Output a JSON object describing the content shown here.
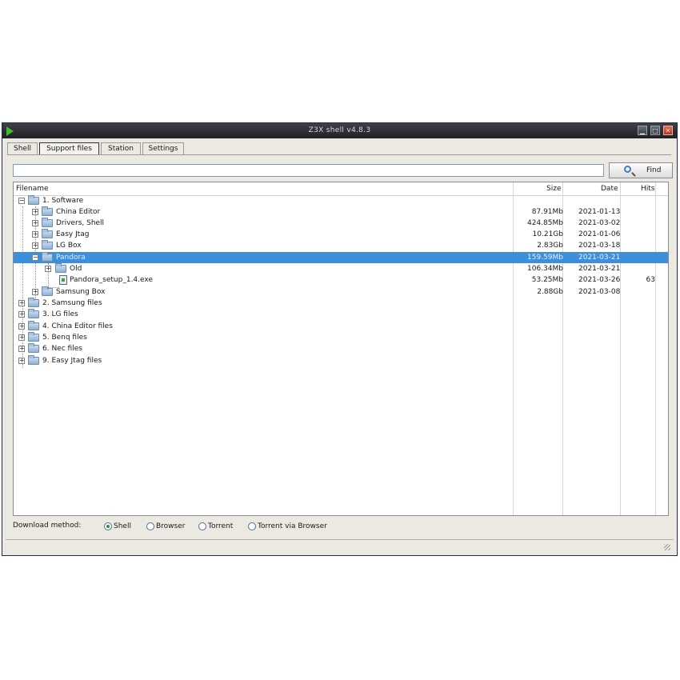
{
  "window": {
    "title": "Z3X shell v4.8.3"
  },
  "tabs": [
    {
      "label": "Shell",
      "active": false
    },
    {
      "label": "Support files",
      "active": true
    },
    {
      "label": "Station",
      "active": false
    },
    {
      "label": "Settings",
      "active": false
    }
  ],
  "search": {
    "value": "",
    "find_label": "Find"
  },
  "columns": {
    "filename": "Filename",
    "size": "Size",
    "date": "Date",
    "hits": "Hits"
  },
  "rows": [
    {
      "expander": "−",
      "icon": "folder",
      "name": "1. Software",
      "size": "",
      "date": "",
      "hits": ""
    },
    {
      "expander": "+",
      "icon": "folder",
      "name": "China Editor",
      "size": "87.91Mb",
      "date": "2021-01-13",
      "hits": ""
    },
    {
      "expander": "+",
      "icon": "folder",
      "name": "Drivers, Shell",
      "size": "424.85Mb",
      "date": "2021-03-02",
      "hits": ""
    },
    {
      "expander": "+",
      "icon": "folder",
      "name": "Easy Jtag",
      "size": "10.21Gb",
      "date": "2021-01-06",
      "hits": ""
    },
    {
      "expander": "+",
      "icon": "folder",
      "name": "LG Box",
      "size": "2.83Gb",
      "date": "2021-03-18",
      "hits": ""
    },
    {
      "expander": "−",
      "icon": "folder",
      "name": "Pandora",
      "size": "159.59Mb",
      "date": "2021-03-21",
      "hits": "",
      "selected": true
    },
    {
      "expander": "+",
      "icon": "folder",
      "name": "Old",
      "size": "106.34Mb",
      "date": "2021-03-21",
      "hits": ""
    },
    {
      "expander": "",
      "icon": "file",
      "name": "Pandora_setup_1.4.exe",
      "size": "53.25Mb",
      "date": "2021-03-26",
      "hits": "63"
    },
    {
      "expander": "+",
      "icon": "folder",
      "name": "Samsung Box",
      "size": "2.88Gb",
      "date": "2021-03-08",
      "hits": ""
    },
    {
      "expander": "+",
      "icon": "folder",
      "name": "2. Samsung files",
      "size": "",
      "date": "",
      "hits": ""
    },
    {
      "expander": "+",
      "icon": "folder",
      "name": "3. LG files",
      "size": "",
      "date": "",
      "hits": ""
    },
    {
      "expander": "+",
      "icon": "folder",
      "name": "4. China Editor files",
      "size": "",
      "date": "",
      "hits": ""
    },
    {
      "expander": "+",
      "icon": "folder",
      "name": "5. Benq files",
      "size": "",
      "date": "",
      "hits": ""
    },
    {
      "expander": "+",
      "icon": "folder",
      "name": "6. Nec files",
      "size": "",
      "date": "",
      "hits": ""
    },
    {
      "expander": "+",
      "icon": "folder",
      "name": "9. Easy Jtag files",
      "size": "",
      "date": "",
      "hits": ""
    }
  ],
  "download": {
    "label": "Download method:",
    "options": [
      {
        "label": "Shell",
        "selected": true
      },
      {
        "label": "Browser",
        "selected": false
      },
      {
        "label": "Torrent",
        "selected": false
      },
      {
        "label": "Torrent via Browser",
        "selected": false
      }
    ]
  },
  "colors": {
    "selection": "#3d8fdc",
    "titlebar": "#2a2c31"
  }
}
